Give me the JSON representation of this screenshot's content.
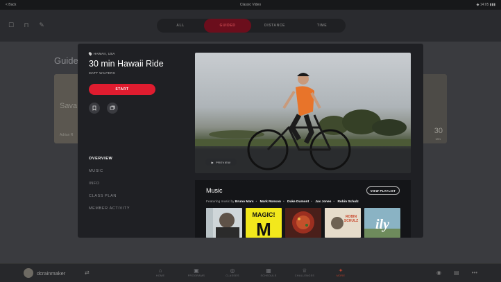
{
  "statusbar": {
    "left": "< Back",
    "center": "Classic Video",
    "right": "◆ 14:05  ▮▮▮"
  },
  "topnav": {
    "tabs": [
      {
        "label": "ALL"
      },
      {
        "label": "GUIDED"
      },
      {
        "label": "DISTANCE"
      },
      {
        "label": "TIME"
      }
    ]
  },
  "background": {
    "section_title": "Guided",
    "left_card_title": "Sava",
    "left_card_sub": "Adrian R",
    "right_card_number": "30",
    "right_card_unit": "MIN"
  },
  "modal": {
    "location": "HAWAII, USA",
    "title": "30 min Hawaii Ride",
    "instructor": "MATT WILPERS",
    "start_label": "START",
    "nav": [
      {
        "label": "OVERVIEW"
      },
      {
        "label": "MUSIC"
      },
      {
        "label": "INFO"
      },
      {
        "label": "CLASS PLAN"
      },
      {
        "label": "MEMBER ACTIVITY"
      }
    ],
    "preview_label": "PREVIEW",
    "music": {
      "title": "Music",
      "view_playlist_label": "VIEW PLAYLIST",
      "featuring_prefix": "Featuring music by",
      "artists": [
        "Bruno Mars",
        "Mark Ronson",
        "Duke Dumont",
        "Jax Jones",
        "Robin Schulz"
      ],
      "albums": [
        {
          "art_text": ""
        },
        {
          "art_text": "MAGIC! M"
        },
        {
          "art_text": ""
        },
        {
          "art_text": "ROBIN SCHULZ"
        },
        {
          "art_text": "ily"
        }
      ]
    }
  },
  "bottombar": {
    "username": "dcrainmaker",
    "nav": [
      {
        "label": "HOME"
      },
      {
        "label": "PROGRAMS"
      },
      {
        "label": "CLASSES"
      },
      {
        "label": "SCHEDULE"
      },
      {
        "label": "CHALLENGES"
      },
      {
        "label": "MORE"
      }
    ]
  },
  "colors": {
    "accent": "#df1c2f",
    "background": "#1b1c1f",
    "modal": "#1f2024"
  }
}
